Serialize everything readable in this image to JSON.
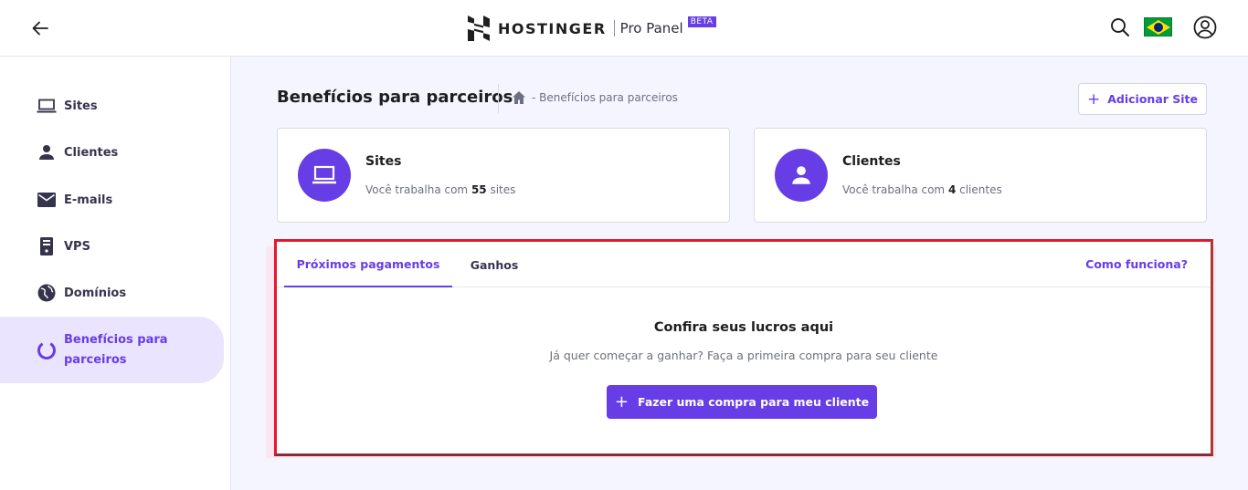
{
  "header": {
    "brand_name": "HOSTINGER",
    "panel_name": "Pro Panel",
    "beta_badge": "BETA"
  },
  "sidebar": {
    "items": [
      {
        "label": "Sites",
        "icon": "laptop-icon"
      },
      {
        "label": "Clientes",
        "icon": "person-icon"
      },
      {
        "label": "E-mails",
        "icon": "envelope-icon"
      },
      {
        "label": "VPS",
        "icon": "server-icon"
      },
      {
        "label": "Domínios",
        "icon": "globe-icon"
      },
      {
        "label": "Benefícios para parceiros",
        "icon": "ring-icon",
        "active": true
      }
    ]
  },
  "page": {
    "title": "Benefícios para parceiros",
    "breadcrumb": "- Benefícios para parceiros",
    "add_site_label": "Adicionar Site"
  },
  "cards": [
    {
      "title": "Sites",
      "prefix": "Você trabalha com ",
      "count": "55",
      "suffix": " sites"
    },
    {
      "title": "Clientes",
      "prefix": "Você trabalha com ",
      "count": "4",
      "suffix": " clientes"
    }
  ],
  "tabs": {
    "items": [
      "Próximos pagamentos",
      "Ganhos"
    ],
    "active": "Próximos pagamentos",
    "help_link": "Como funciona?"
  },
  "empty_state": {
    "title": "Confira seus lucros aqui",
    "subtitle": "Já quer começar a ganhar? Faça a primeira compra para seu cliente",
    "cta_label": "Fazer uma compra para meu cliente"
  },
  "colors": {
    "accent": "#673de6",
    "highlight_border": "#e31a2d"
  }
}
